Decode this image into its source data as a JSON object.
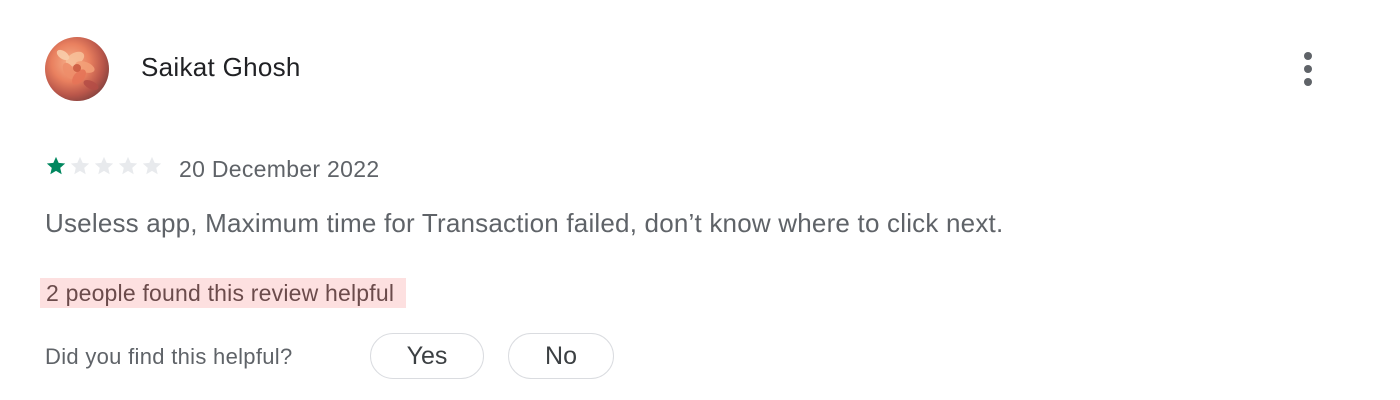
{
  "review": {
    "author": "Saikat Ghosh",
    "avatar_icon": "flower-photo-avatar",
    "rating": 1,
    "max_rating": 5,
    "date": "20 December 2022",
    "text": "Useless app, Maximum time for Transaction failed, don’t know where to click next.",
    "helpful_count_text": "2 people found this review helpful"
  },
  "feedback": {
    "question": "Did you find this helpful?",
    "yes_label": "Yes",
    "no_label": "No"
  },
  "menu": {
    "icon": "more-vert-icon"
  },
  "colors": {
    "star_filled": "#01875f",
    "star_empty": "#e8eaed",
    "highlight": "#fde0e0"
  }
}
